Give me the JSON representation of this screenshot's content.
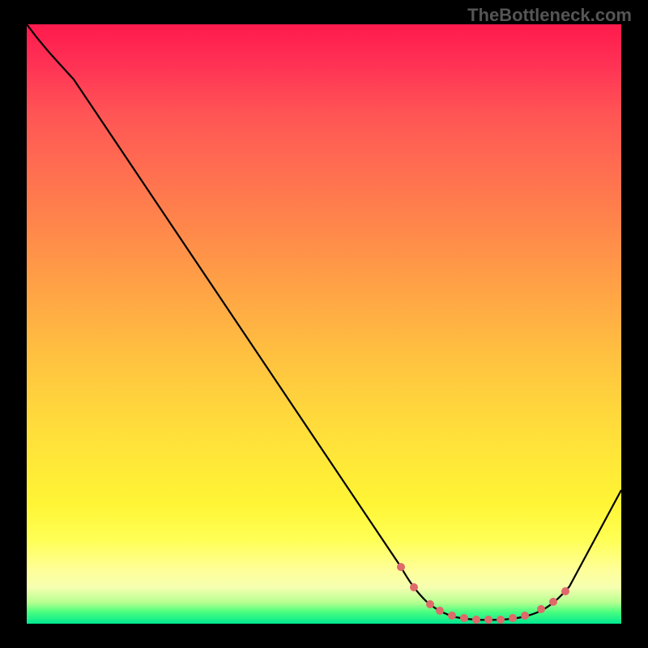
{
  "watermark": "TheBottleneck.com",
  "chart_data": {
    "type": "line",
    "title": "",
    "xlabel": "",
    "ylabel": "",
    "xlim": [
      0,
      100
    ],
    "ylim": [
      0,
      100
    ],
    "series": [
      {
        "name": "curve",
        "x": [
          0,
          4,
          8,
          63,
          66,
          70,
          75,
          80,
          85,
          89,
          92,
          100
        ],
        "y": [
          100,
          96,
          93,
          9,
          4,
          1,
          0,
          0,
          1,
          3,
          6,
          22
        ]
      }
    ],
    "markers": {
      "name": "dots",
      "color": "#e06a6a",
      "x": [
        63,
        66,
        68,
        71,
        74,
        77,
        80,
        83,
        85,
        87,
        89,
        91
      ],
      "y": [
        9,
        4,
        2,
        1,
        0.5,
        0.3,
        0.3,
        0.7,
        1,
        2,
        3,
        5
      ]
    },
    "background_gradient": {
      "top": "#ff1a4d",
      "bottom": "#00e890"
    }
  }
}
